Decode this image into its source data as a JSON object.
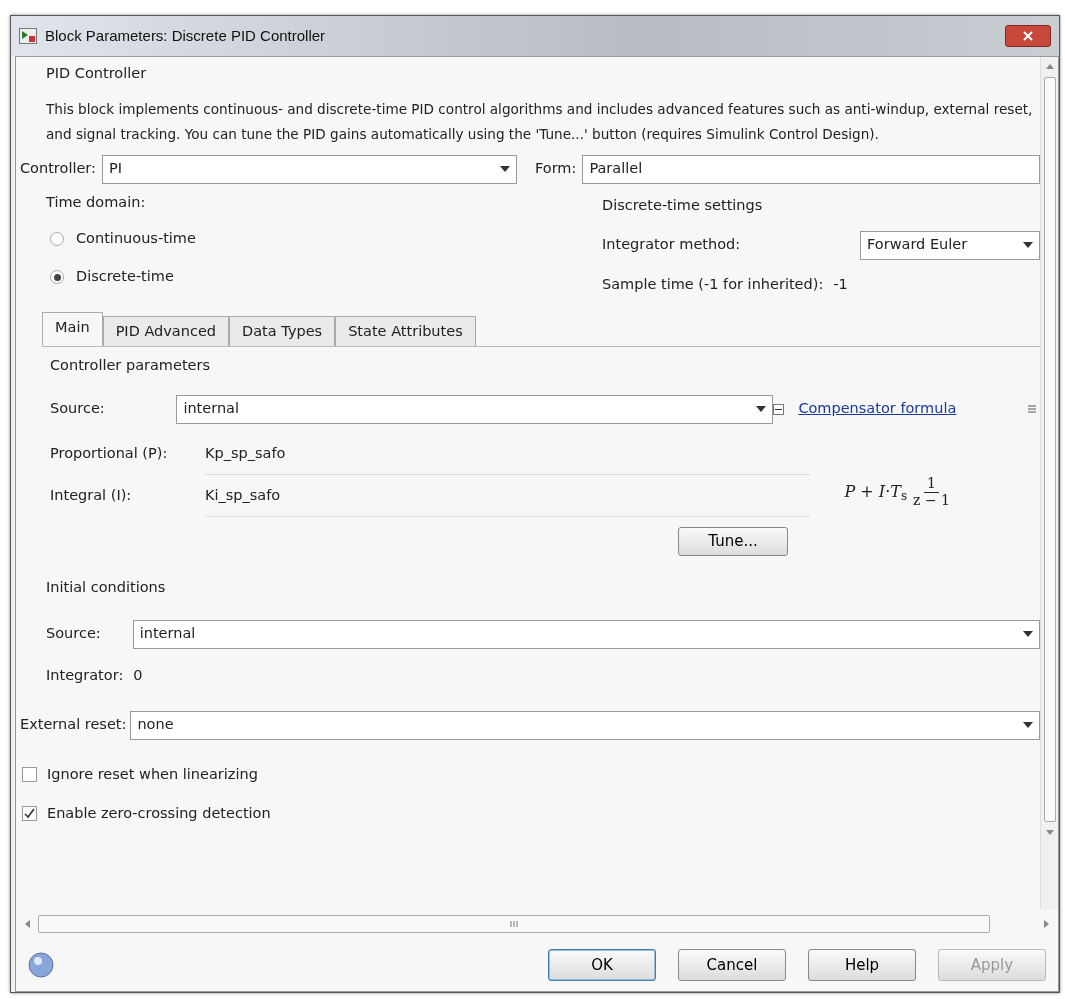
{
  "window": {
    "title": "Block Parameters: Discrete PID Controller"
  },
  "header": {
    "title": "PID Controller",
    "description": "This block implements continuous- and discrete-time PID control algorithms and includes advanced features such as anti-windup, external reset, and signal tracking. You can tune the PID gains automatically using the 'Tune...' button (requires Simulink Control Design)."
  },
  "controller": {
    "label": "Controller:",
    "value": "PI"
  },
  "form": {
    "label": "Form:",
    "value": "Parallel"
  },
  "time_domain": {
    "label": "Time domain:",
    "options": [
      {
        "label": "Continuous-time",
        "selected": false
      },
      {
        "label": "Discrete-time",
        "selected": true
      }
    ]
  },
  "discrete_settings": {
    "title": "Discrete-time settings",
    "integrator_method": {
      "label": "Integrator method:",
      "value": "Forward Euler"
    },
    "sample_time": {
      "label": "Sample time (-1 for inherited):",
      "value": "-1"
    }
  },
  "tabs": [
    {
      "label": "Main",
      "selected": true
    },
    {
      "label": "PID Advanced",
      "selected": false
    },
    {
      "label": "Data Types",
      "selected": false
    },
    {
      "label": "State Attributes",
      "selected": false
    }
  ],
  "controller_parameters": {
    "title": "Controller parameters",
    "source": {
      "label": "Source:",
      "value": "internal"
    },
    "compensator": {
      "text": "Compensator formula",
      "expanded": true
    },
    "params": [
      {
        "label": "Proportional (P):",
        "value": "Kp_sp_safo"
      },
      {
        "label": "Integral (I):",
        "value": "Ki_sp_safo"
      }
    ],
    "formula": {
      "expression": "*P* + *I*·*T*$_{s}$",
      "numerator": "1",
      "denominator": "z − 1"
    },
    "tune_button": "Tune..."
  },
  "initial_conditions": {
    "title": "Initial conditions",
    "source": {
      "label": "Source:",
      "value": "internal"
    },
    "integrator": {
      "label": "Integrator:",
      "value": "0"
    }
  },
  "external_reset": {
    "label": "External reset:",
    "value": "none"
  },
  "checkboxes": [
    {
      "label": "Ignore reset when linearizing",
      "checked": false
    },
    {
      "label": "Enable zero-crossing detection",
      "checked": true
    }
  ],
  "buttons": [
    {
      "label": "OK",
      "default": true,
      "disabled": false
    },
    {
      "label": "Cancel",
      "default": false,
      "disabled": false
    },
    {
      "label": "Help",
      "default": false,
      "disabled": false
    },
    {
      "label": "Apply",
      "default": false,
      "disabled": true
    }
  ]
}
